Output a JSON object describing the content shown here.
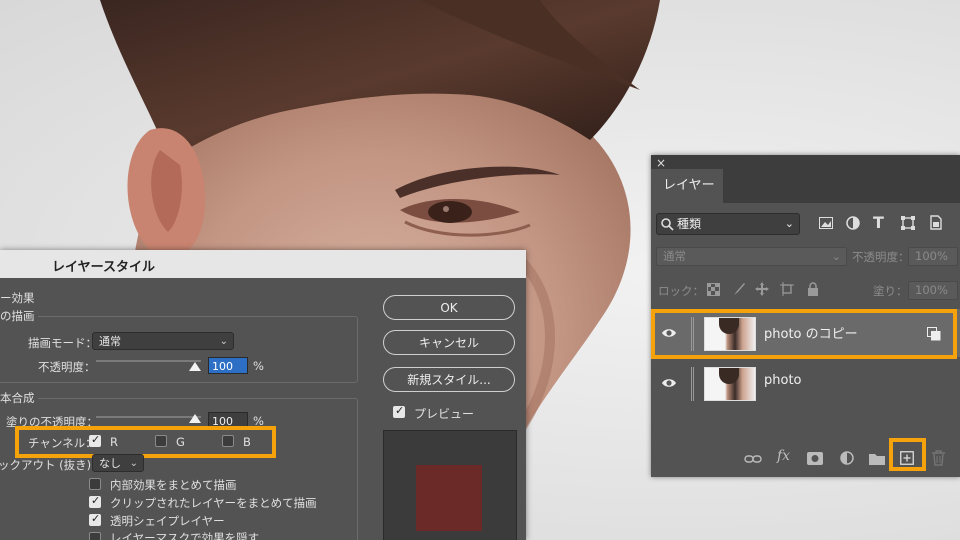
{
  "layer_style_dialog": {
    "title": "レイヤースタイル",
    "section_effects": "ー効果",
    "section_draw": "の描画",
    "blend_mode_label": "描画モード：",
    "blend_mode_value": "通常",
    "opacity_label": "不透明度：",
    "opacity_value": "100",
    "percent": "%",
    "section_advanced": "本合成",
    "fill_opacity_label": "塗りの不透明度：",
    "fill_opacity_value": "100",
    "channels_label": "チャンネル：",
    "channel_r": "R",
    "channel_g": "G",
    "channel_b": "B",
    "channel_r_checked": true,
    "channel_g_checked": false,
    "channel_b_checked": false,
    "knockout_label": "ックアウト (抜き)：",
    "knockout_value": "なし",
    "options": [
      {
        "label": "内部効果をまとめて描画",
        "checked": false
      },
      {
        "label": "クリップされたレイヤーをまとめて描画",
        "checked": true
      },
      {
        "label": "透明シェイプレイヤー",
        "checked": true
      },
      {
        "label": "レイヤーマスクで効果を隠す",
        "checked": false
      }
    ],
    "ok_label": "OK",
    "cancel_label": "キャンセル",
    "new_style_label": "新規スタイル...",
    "preview_label": "プレビュー",
    "preview_checked": true,
    "preview_color": "#6b2a27",
    "highlight_color": "#f6a20a"
  },
  "layers_panel": {
    "close_glyph": "×",
    "tab_label": "レイヤー",
    "filter_kind": "種類",
    "blend_mode": "通常",
    "opacity_label": "不透明度：",
    "opacity_value": "100%",
    "lock_label": "ロック：",
    "fill_label": "塗り：",
    "fill_value": "100%",
    "layers": [
      {
        "name": "photo のコピー",
        "selected": true,
        "visible": true
      },
      {
        "name": "photo",
        "selected": false,
        "visible": true
      }
    ],
    "bottom_icons": [
      "link-icon",
      "fx-icon",
      "mask-icon",
      "adjustment-icon",
      "folder-icon",
      "new-layer-icon",
      "trash-icon"
    ],
    "fx_text": "fx"
  }
}
